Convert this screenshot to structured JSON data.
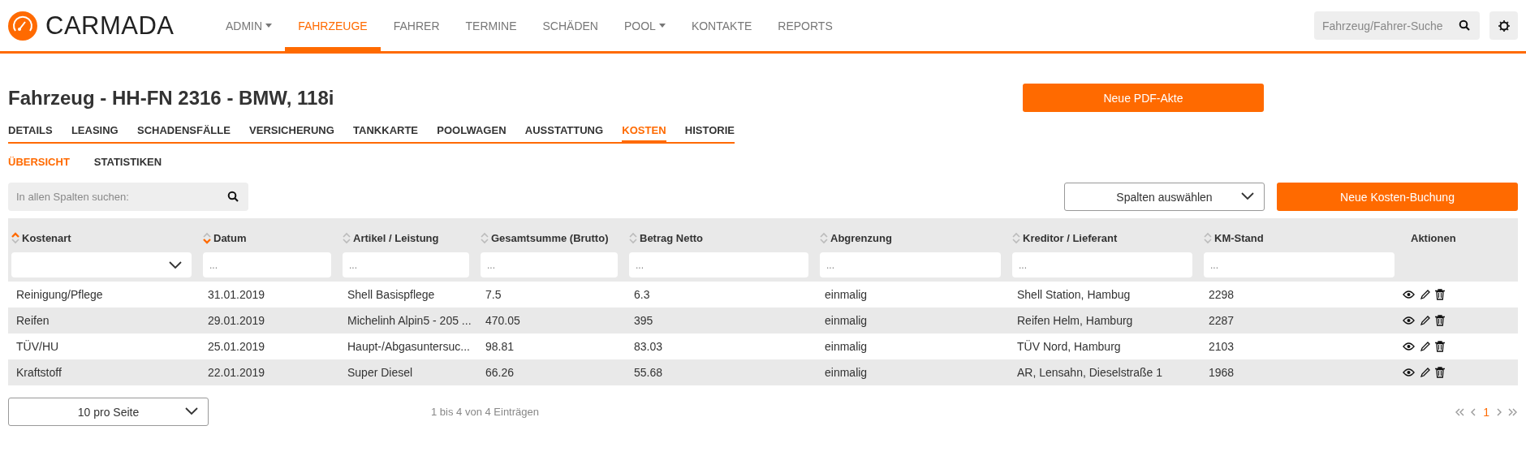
{
  "brand": {
    "name": "CARMADA"
  },
  "nav": [
    {
      "label": "ADMIN",
      "dropdown": true,
      "selected": false
    },
    {
      "label": "FAHRZEUGE",
      "dropdown": false,
      "selected": true
    },
    {
      "label": "FAHRER",
      "dropdown": false,
      "selected": false
    },
    {
      "label": "TERMINE",
      "dropdown": false,
      "selected": false
    },
    {
      "label": "SCHÄDEN",
      "dropdown": false,
      "selected": false
    },
    {
      "label": "POOL",
      "dropdown": true,
      "selected": false
    },
    {
      "label": "KONTAKTE",
      "dropdown": false,
      "selected": false
    },
    {
      "label": "REPORTS",
      "dropdown": false,
      "selected": false
    }
  ],
  "global_search": {
    "placeholder": "Fahrzeug/Fahrer-Suche"
  },
  "page_title": "Fahrzeug - HH-FN 2316 - BMW, 118i",
  "pdf_button": "Neue PDF-Akte",
  "tabs": [
    {
      "label": "DETAILS",
      "selected": false
    },
    {
      "label": "LEASING",
      "selected": false
    },
    {
      "label": "SCHADENSFÄLLE",
      "selected": false
    },
    {
      "label": "VERSICHERUNG",
      "selected": false
    },
    {
      "label": "TANKKARTE",
      "selected": false
    },
    {
      "label": "POOLWAGEN",
      "selected": false
    },
    {
      "label": "AUSSTATTUNG",
      "selected": false
    },
    {
      "label": "KOSTEN",
      "selected": true
    },
    {
      "label": "HISTORIE",
      "selected": false
    }
  ],
  "subtabs": [
    {
      "label": "ÜBERSICHT",
      "selected": true
    },
    {
      "label": "STATISTIKEN",
      "selected": false
    }
  ],
  "table_search": {
    "placeholder": "In allen Spalten suchen:"
  },
  "column_select": "Spalten auswählen",
  "new_cost_button": "Neue Kosten-Buchung",
  "table": {
    "columns": [
      {
        "label": "Kostenart",
        "sortable": true,
        "sort_ascending": true,
        "sort_descending": false
      },
      {
        "label": "Datum",
        "sortable": true,
        "sort_ascending": false,
        "sort_descending": true
      },
      {
        "label": "Artikel / Leistung",
        "sortable": true,
        "sort_ascending": false,
        "sort_descending": false
      },
      {
        "label": "Gesamtsumme (Brutto)",
        "sortable": true,
        "sort_ascending": false,
        "sort_descending": false
      },
      {
        "label": "Betrag Netto",
        "sortable": true,
        "sort_ascending": false,
        "sort_descending": false
      },
      {
        "label": "Abgrenzung",
        "sortable": true,
        "sort_ascending": false,
        "sort_descending": false
      },
      {
        "label": "Kreditor / Lieferant",
        "sortable": true,
        "sort_ascending": false,
        "sort_descending": false
      },
      {
        "label": "KM-Stand",
        "sortable": true,
        "sort_ascending": false,
        "sort_descending": false
      },
      {
        "label": "Aktionen",
        "sortable": false
      }
    ],
    "filters": [
      {
        "kind": "select"
      },
      {
        "kind": "text",
        "placeholder": "..."
      },
      {
        "kind": "text",
        "placeholder": "..."
      },
      {
        "kind": "text",
        "placeholder": "..."
      },
      {
        "kind": "text",
        "placeholder": "..."
      },
      {
        "kind": "text",
        "placeholder": "..."
      },
      {
        "kind": "text",
        "placeholder": "..."
      },
      {
        "kind": "text",
        "placeholder": "..."
      }
    ],
    "rows": [
      [
        "Reinigung/Pflege",
        "31.01.2019",
        "Shell Basispflege",
        "7.5",
        "6.3",
        "einmalig",
        "Shell Station, Hambug",
        "2298"
      ],
      [
        "Reifen",
        "29.01.2019",
        "Michelinh Alpin5 - 205 ...",
        "470.05",
        "395",
        "einmalig",
        "Reifen Helm, Hamburg",
        "2287"
      ],
      [
        "TÜV/HU",
        "25.01.2019",
        "Haupt-/Abgasuntersuc...",
        "98.81",
        "83.03",
        "einmalig",
        "TÜV Nord, Hamburg",
        "2103"
      ],
      [
        "Kraftstoff",
        "22.01.2019",
        "Super Diesel",
        "66.26",
        "55.68",
        "einmalig",
        "AR, Lensahn, Dieselstraße 1",
        "1968"
      ]
    ]
  },
  "page_size": "10 pro Seite",
  "info": "1 bis 4 von 4 Einträgen",
  "pagination": [
    {
      "label": "1",
      "selected": true
    }
  ]
}
